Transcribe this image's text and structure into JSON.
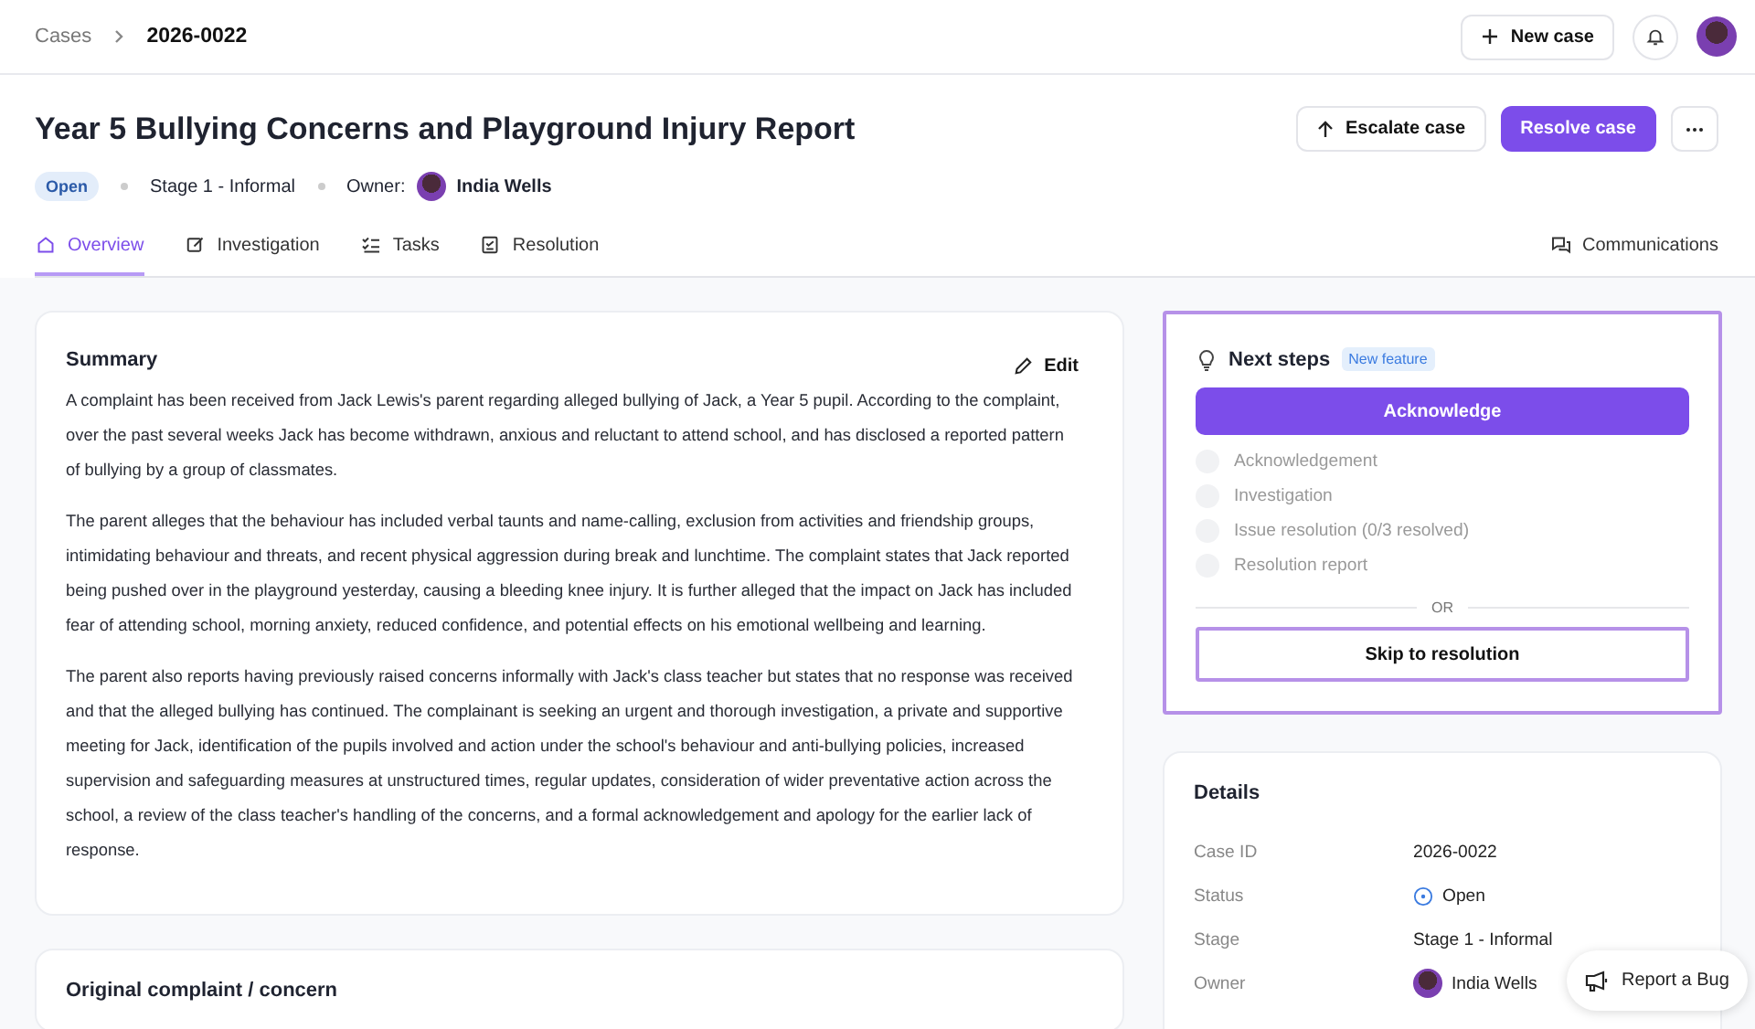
{
  "breadcrumb": {
    "parent": "Cases",
    "current": "2026-0022"
  },
  "top_actions": {
    "new_case": "New case"
  },
  "case": {
    "title": "Year 5 Bullying Concerns and Playground Injury Report",
    "status": "Open",
    "stage": "Stage 1 - Informal",
    "owner_label": "Owner:",
    "owner": "India Wells"
  },
  "header_actions": {
    "escalate": "Escalate case",
    "resolve": "Resolve case"
  },
  "tabs": [
    {
      "label": "Overview",
      "selected": true
    },
    {
      "label": "Investigation",
      "selected": false
    },
    {
      "label": "Tasks",
      "selected": false
    },
    {
      "label": "Resolution",
      "selected": false
    }
  ],
  "communications": "Communications",
  "summary": {
    "title": "Summary",
    "edit": "Edit",
    "paragraphs": [
      "A complaint has been received from Jack Lewis's parent regarding alleged bullying of Jack, a Year 5 pupil. According to the complaint, over the past several weeks Jack has become withdrawn, anxious and reluctant to attend school, and has disclosed a reported pattern of bullying by a group of classmates.",
      "The parent alleges that the behaviour has included verbal taunts and name-calling, exclusion from activities and friendship groups, intimidating behaviour and threats, and recent physical aggression during break and lunchtime. The complaint states that Jack reported being pushed over in the playground yesterday, causing a bleeding knee injury. It is further alleged that the impact on Jack has included fear of attending school, morning anxiety, reduced confidence, and potential effects on his emotional wellbeing and learning.",
      "The parent also reports having previously raised concerns informally with Jack's class teacher but states that no response was received and that the alleged bullying has continued. The complainant is seeking an urgent and thorough investigation, a private and supportive meeting for Jack, identification of the pupils involved and action under the school's behaviour and anti-bullying policies, increased supervision and safeguarding measures at unstructured times, regular updates, consideration of wider preventative action across the school, a review of the class teacher's handling of the concerns, and a formal acknowledgement and apology for the earlier lack of response."
    ]
  },
  "original_complaint": {
    "title": "Original complaint / concern"
  },
  "next_steps": {
    "title": "Next steps",
    "badge": "New feature",
    "primary": "Acknowledge",
    "steps": [
      {
        "label": "Acknowledgement",
        "done": false
      },
      {
        "label": "Investigation",
        "done": false
      },
      {
        "label": "Issue resolution (0/3 resolved)",
        "done": false
      },
      {
        "label": "Resolution report",
        "done": false
      }
    ],
    "divider": "OR",
    "skip": "Skip to resolution"
  },
  "details": {
    "title": "Details",
    "rows": [
      {
        "label": "Case ID",
        "value": "2026-0022",
        "kind": "text"
      },
      {
        "label": "Status",
        "value": "Open",
        "kind": "status"
      },
      {
        "label": "Stage",
        "value": "Stage 1 - Informal",
        "kind": "text"
      },
      {
        "label": "Owner",
        "value": "India Wells",
        "kind": "person"
      }
    ]
  },
  "report_bug": "Report a Bug"
}
